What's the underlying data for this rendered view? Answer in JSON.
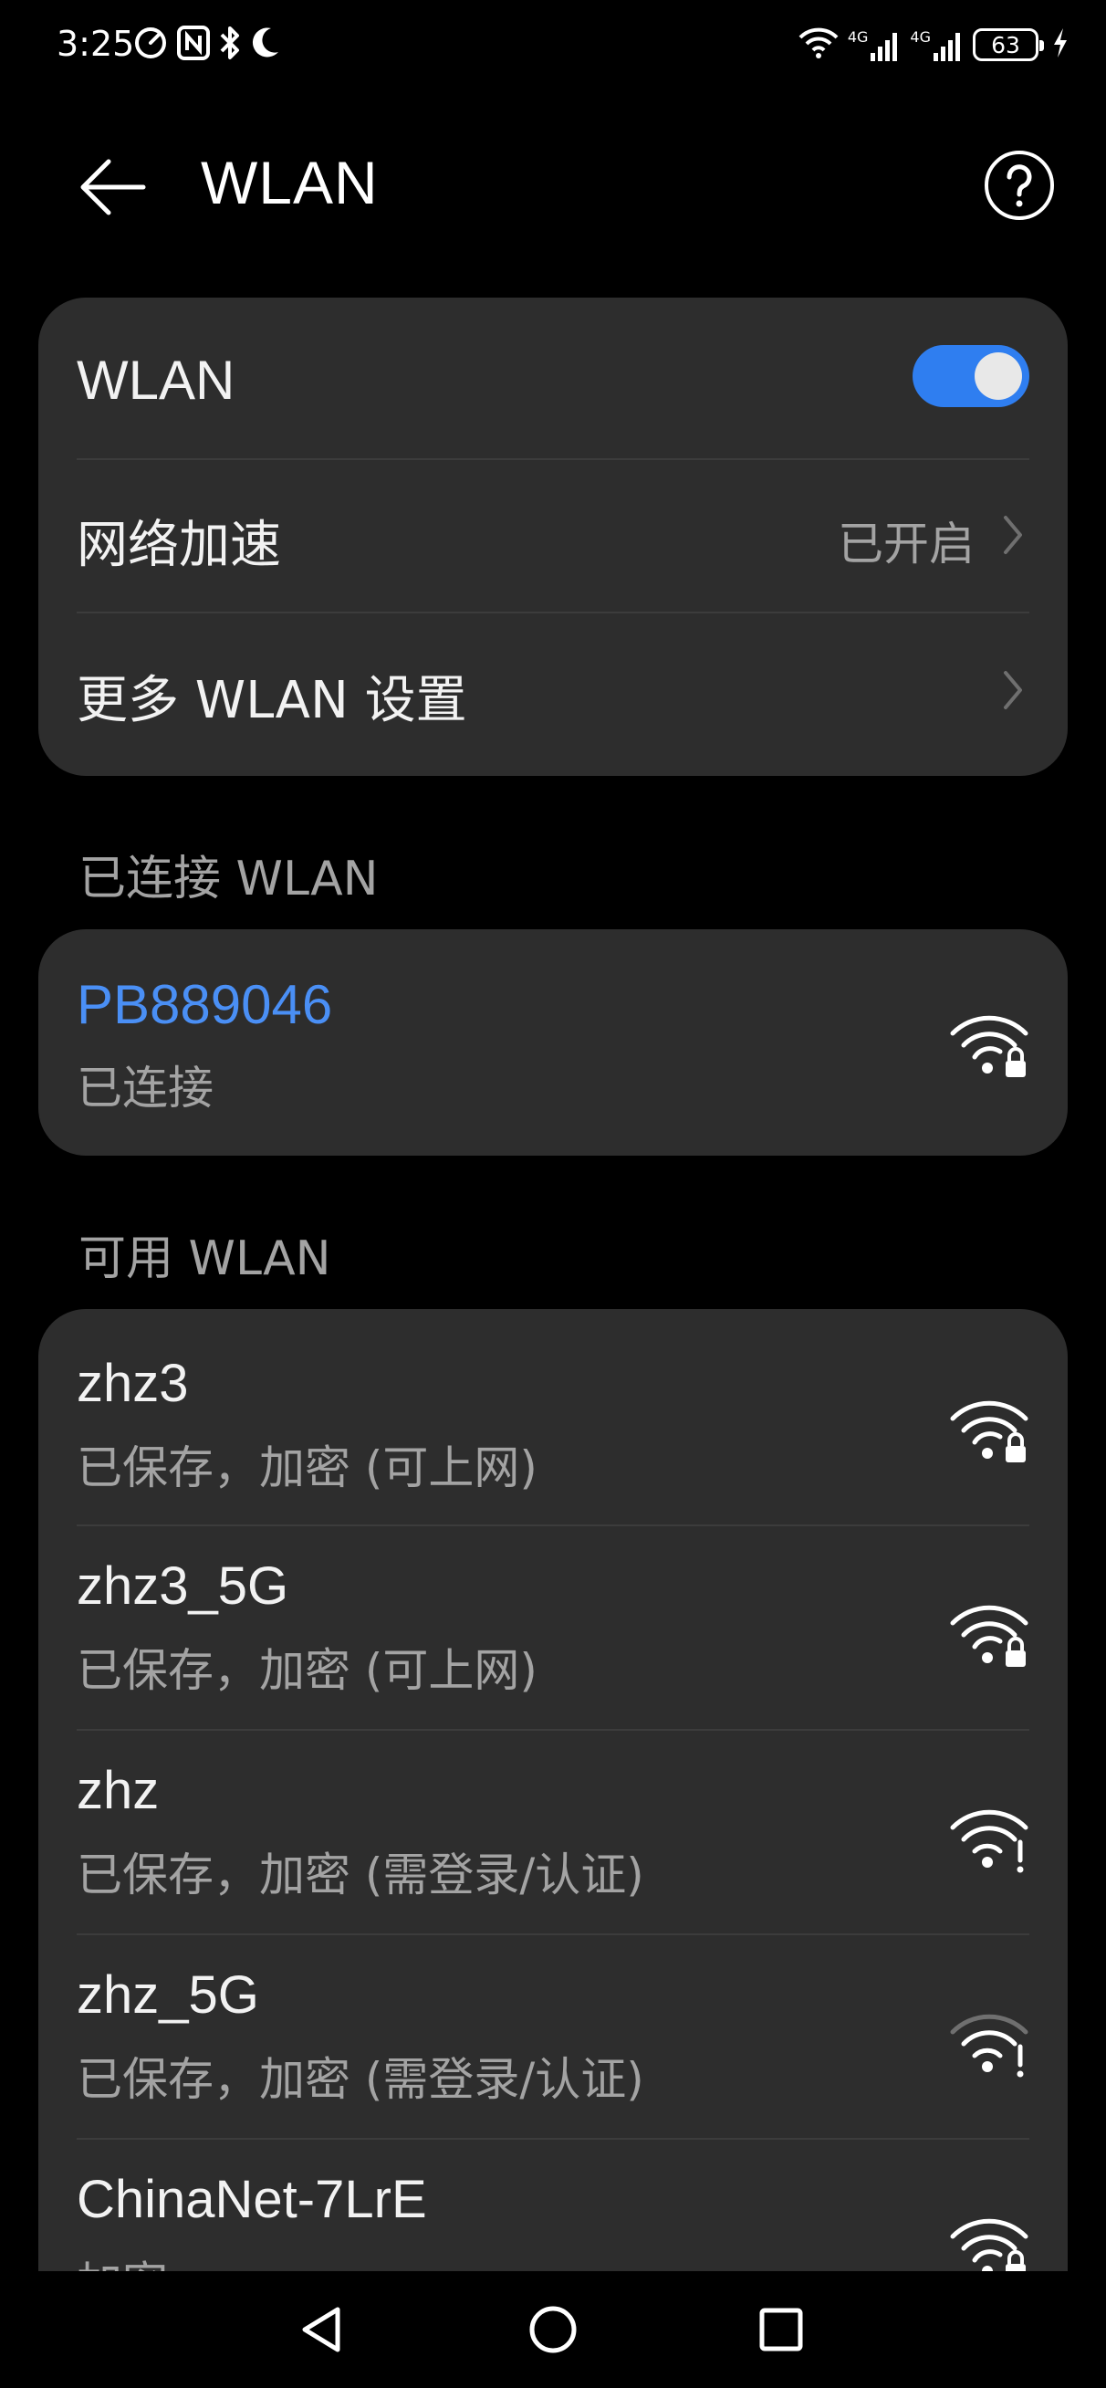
{
  "status_bar": {
    "time": "3:25",
    "battery_level": "63",
    "network_1": "4G",
    "network_2": "4G",
    "icons_left": [
      "data-saver-icon",
      "nfc-icon",
      "bluetooth-icon",
      "moon-icon"
    ],
    "icons_right": [
      "wifi-icon",
      "signal-4g-icon",
      "signal-4g-icon",
      "battery-icon",
      "charging-icon"
    ]
  },
  "header": {
    "title": "WLAN",
    "back_icon": "back-arrow-icon",
    "help_icon": "help-icon"
  },
  "settings_card": {
    "wlan_label": "WLAN",
    "wlan_enabled": true,
    "accel_label": "网络加速",
    "accel_value": "已开启",
    "more_label": "更多 WLAN 设置"
  },
  "connected_section": {
    "label": "已连接 WLAN",
    "network": {
      "ssid": "PB889046",
      "status": "已连接",
      "icon": "wifi-lock-icon"
    }
  },
  "available_section": {
    "label": "可用 WLAN",
    "networks": [
      {
        "ssid": "zhz3",
        "status": "已保存，加密 (可上网)",
        "icon": "wifi-lock-icon"
      },
      {
        "ssid": "zhz3_5G",
        "status": "已保存，加密 (可上网)",
        "icon": "wifi-lock-icon"
      },
      {
        "ssid": "zhz",
        "status": "已保存，加密 (需登录/认证)",
        "icon": "wifi-alert-icon"
      },
      {
        "ssid": "zhz_5G",
        "status": "已保存，加密 (需登录/认证)",
        "icon": "wifi-alert-icon"
      },
      {
        "ssid": "ChinaNet-7LrE",
        "status": "加密",
        "icon": "wifi-lock-icon"
      }
    ]
  },
  "colors": {
    "accent": "#2f7ef0",
    "connected_text": "#4a8ff5",
    "card_bg": "#2d2d2d",
    "secondary_text": "#a3a3a3"
  },
  "nav_bar": {
    "back": "nav-back-icon",
    "home": "nav-home-icon",
    "recents": "nav-recents-icon"
  }
}
